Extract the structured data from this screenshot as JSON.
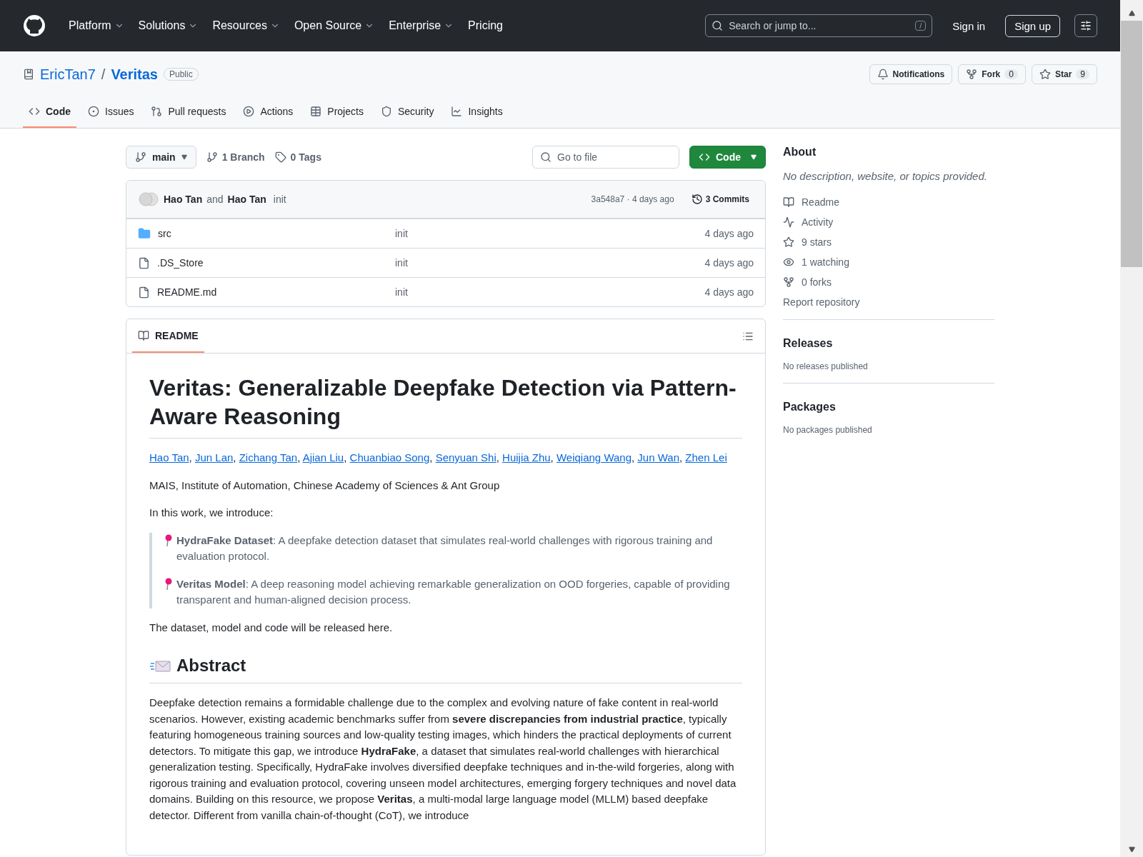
{
  "header": {
    "nav": [
      {
        "label": "Platform",
        "dropdown": true
      },
      {
        "label": "Solutions",
        "dropdown": true
      },
      {
        "label": "Resources",
        "dropdown": true
      },
      {
        "label": "Open Source",
        "dropdown": true
      },
      {
        "label": "Enterprise",
        "dropdown": true
      },
      {
        "label": "Pricing",
        "dropdown": false
      }
    ],
    "search": {
      "placeholder": "Search or jump to...",
      "shortcut": "/"
    },
    "sign_in": "Sign in",
    "sign_up": "Sign up"
  },
  "repo": {
    "owner": "EricTan7",
    "separator": "/",
    "name": "Veritas",
    "visibility": "Public",
    "actions": [
      {
        "kind": "notifications",
        "label": "Notifications"
      },
      {
        "kind": "fork",
        "label": "Fork",
        "count": "0"
      },
      {
        "kind": "star",
        "label": "Star",
        "count": "9"
      }
    ]
  },
  "tabs": [
    {
      "kind": "code",
      "label": "Code",
      "selected": true
    },
    {
      "kind": "issues",
      "label": "Issues",
      "selected": false
    },
    {
      "kind": "pulls",
      "label": "Pull requests",
      "selected": false
    },
    {
      "kind": "actions",
      "label": "Actions",
      "selected": false
    },
    {
      "kind": "projects",
      "label": "Projects",
      "selected": false
    },
    {
      "kind": "security",
      "label": "Security",
      "selected": false
    },
    {
      "kind": "insights",
      "label": "Insights",
      "selected": false
    }
  ],
  "toolbar": {
    "branch": "main",
    "branches": "1 Branch",
    "tags": "0 Tags",
    "file_search": {
      "placeholder": "Go to file"
    },
    "code_button": "Code"
  },
  "commit": {
    "author_1": "Hao Tan",
    "joiner": "and",
    "author_2": "Hao Tan",
    "message": "init",
    "hash_time": "3a548a7 · 4 days ago",
    "commits": "3 Commits"
  },
  "files": [
    {
      "kind": "folder",
      "name": "src",
      "message": "init",
      "time": "4 days ago"
    },
    {
      "kind": "file",
      "name": ".DS_Store",
      "message": "init",
      "time": "4 days ago"
    },
    {
      "kind": "file",
      "name": "README.md",
      "message": "init",
      "time": "4 days ago"
    }
  ],
  "readme": {
    "tab": "README",
    "title": "Veritas: Generalizable Deepfake Detection via Pattern-Aware Reasoning",
    "authors": [
      "Hao Tan",
      "Jun Lan",
      "Zichang Tan",
      "Ajian Liu",
      "Chuanbiao Song",
      "Senyuan Shi",
      "Huijia Zhu",
      "Weiqiang Wang",
      "Jun Wan",
      "Zhen Lei"
    ],
    "author_separator": ", ",
    "affiliation": "MAIS, Institute of Automation, Chinese Academy of Sciences & Ant Group",
    "intro": "In this work, we introduce:",
    "quote": [
      "**HydraFake Dataset**: A deepfake detection dataset that simulates real-world challenges with rigorous training and evaluation protocol.",
      "**Veritas Model**: A deep reasoning model achieving remarkable generalization on OOD forgeries, capable of providing transparent and human-aligned decision process."
    ],
    "note": "The dataset, model and code will be released here.",
    "abstract_heading": "Abstract",
    "abstract": "Deepfake detection remains a formidable challenge due to the complex and evolving nature of fake content in real-world scenarios. However, existing academic benchmarks suffer from **severe discrepancies from industrial practice**, typically featuring homogeneous training sources and low-quality testing images, which hinders the practical deployments of current detectors. To mitigate this gap, we introduce **HydraFake**, a dataset that simulates real-world challenges with hierarchical generalization testing. Specifically, HydraFake involves diversified deepfake techniques and in-the-wild forgeries, along with rigorous training and evaluation protocol, covering unseen model architectures, emerging forgery techniques and novel data domains. Building on this resource, we propose **Veritas**, a multi-modal large language model (MLLM) based deepfake detector. Different from vanilla chain-of-thought (CoT), we introduce"
  },
  "sidebar": {
    "about": "About",
    "description": "No description, website, or topics provided.",
    "links": [
      {
        "kind": "readme",
        "label": "Readme"
      },
      {
        "kind": "activity",
        "label": "Activity"
      },
      {
        "kind": "stars",
        "label": "9 stars"
      },
      {
        "kind": "watching",
        "label": "1 watching"
      },
      {
        "kind": "forks",
        "label": "0 forks"
      }
    ],
    "report": "Report repository",
    "releases": {
      "title": "Releases",
      "text": "No releases published"
    },
    "packages": {
      "title": "Packages",
      "text": "No packages published"
    }
  }
}
